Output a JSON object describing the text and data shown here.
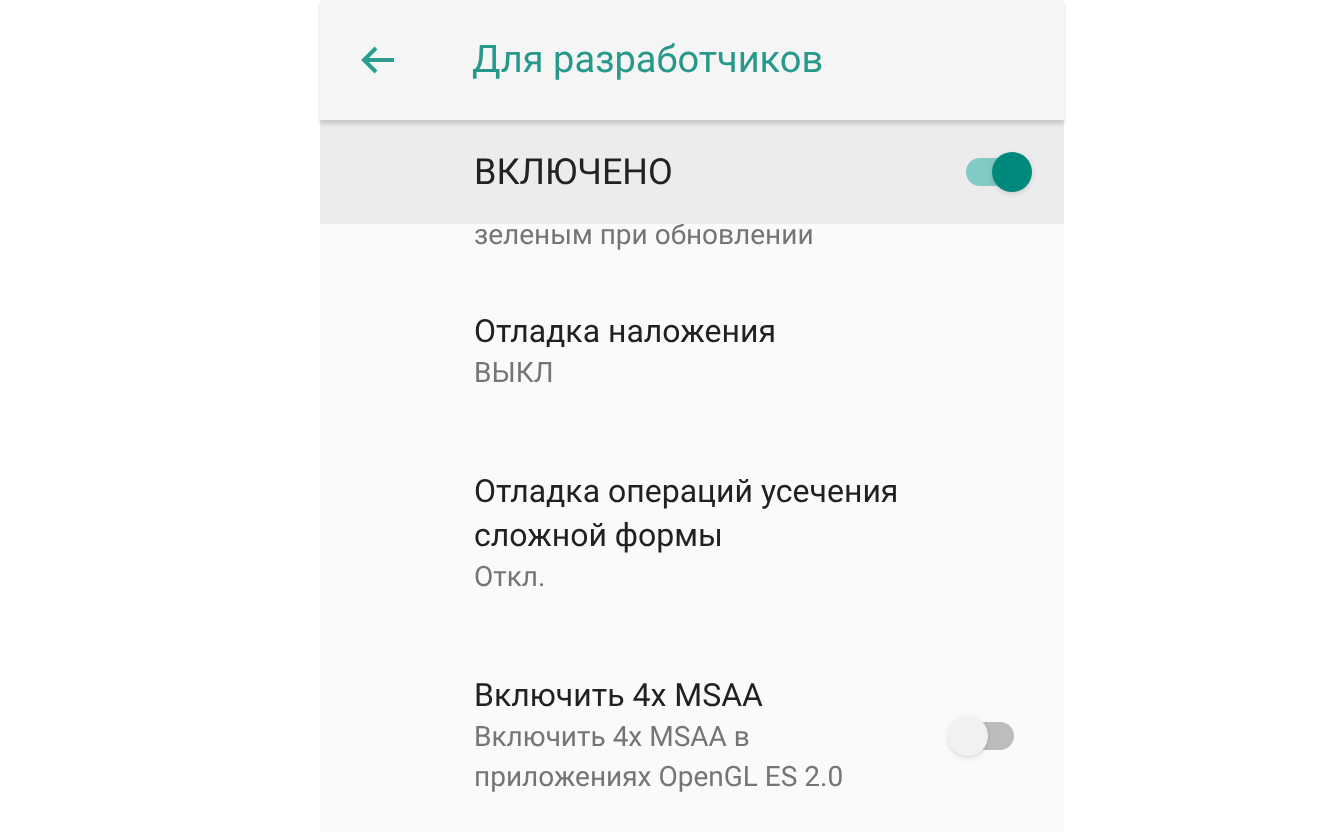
{
  "app_bar": {
    "title": "Для разработчиков"
  },
  "master_switch": {
    "label": "ВКЛЮЧЕНО",
    "on": true
  },
  "settings": [
    {
      "kind": "fragment",
      "summary": "зеленым при обновлении"
    },
    {
      "kind": "option",
      "title": "Отладка наложения",
      "summary": "ВЫКЛ"
    },
    {
      "kind": "option",
      "title": "Отладка операций усечения сложной формы",
      "summary": "Откл."
    },
    {
      "kind": "switch",
      "title": "Включить 4x MSAA",
      "summary": "Включить 4x MSAA в приложениях OpenGL ES 2.0",
      "on": false
    }
  ]
}
